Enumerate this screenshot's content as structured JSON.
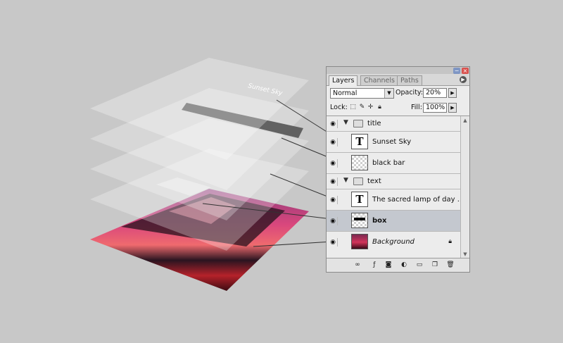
{
  "panel": {
    "tabs": [
      "Layers",
      "Channels",
      "Paths"
    ],
    "blend_mode": "Normal",
    "opacity_label": "Opacity:",
    "opacity_value": "20%",
    "lock_label": "Lock:",
    "fill_label": "Fill:",
    "fill_value": "100%"
  },
  "layers": [
    {
      "name": "title",
      "kind": "group"
    },
    {
      "name": "Sunset Sky",
      "kind": "text",
      "thumb": "T"
    },
    {
      "name": "black bar",
      "kind": "pixel"
    },
    {
      "name": "text",
      "kind": "group"
    },
    {
      "name": "The sacred lamp of day ...",
      "kind": "text",
      "thumb": "T"
    },
    {
      "name": "box",
      "kind": "pixel",
      "selected": true
    },
    {
      "name": "Background",
      "kind": "background"
    }
  ],
  "canvas": {
    "sheet_title": "Sunset Sky"
  }
}
